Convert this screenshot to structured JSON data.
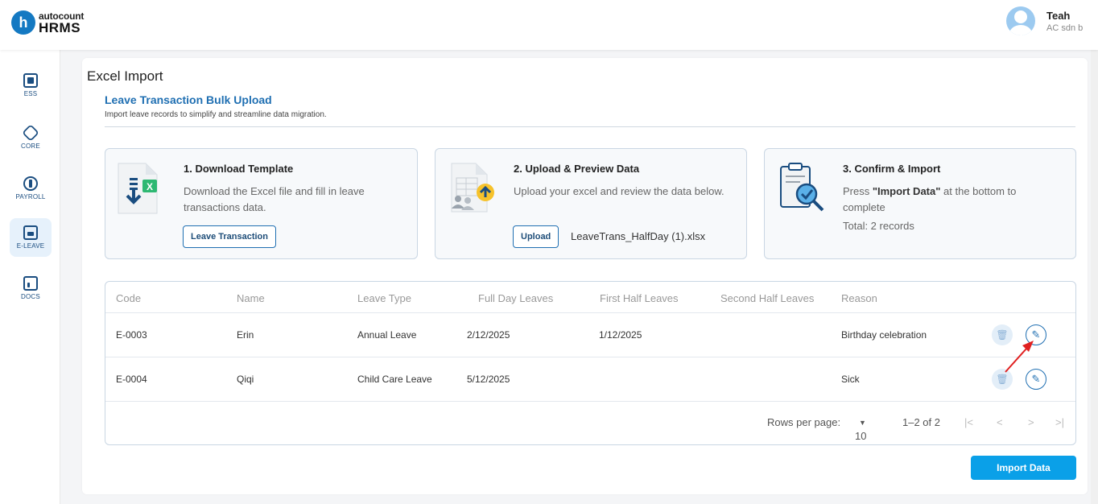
{
  "app": {
    "logo_letter": "h",
    "logo_line1": "autocount",
    "logo_line2": "HRMS"
  },
  "user": {
    "name": "Teah",
    "company": "AC sdn b"
  },
  "sidebar": {
    "items": [
      {
        "label": "ESS",
        "icon": "id-badge-icon"
      },
      {
        "label": "CORE",
        "icon": "cube-icon"
      },
      {
        "label": "PAYROLL",
        "icon": "dollar-coin-icon"
      },
      {
        "label": "E-LEAVE",
        "icon": "calendar-icon"
      },
      {
        "label": "DOCS",
        "icon": "document-chart-icon"
      }
    ]
  },
  "page": {
    "title": "Excel Import",
    "section_title": "Leave Transaction Bulk Upload",
    "section_subtitle": "Import leave records to simplify and streamline data migration."
  },
  "steps": {
    "download": {
      "title": "1. Download Template",
      "description": "Download the Excel file and fill in leave transactions data.",
      "button": "Leave Transaction"
    },
    "upload": {
      "title": "2. Upload & Preview Data",
      "description": "Upload your excel and review the data below.",
      "button": "Upload",
      "file_name": "LeaveTrans_HalfDay (1).xlsx"
    },
    "confirm": {
      "title": "3. Confirm & Import",
      "desc_prefix": "Press ",
      "desc_bold": "\"Import Data\"",
      "desc_suffix": " at the bottom to complete",
      "total": "Total: 2 records"
    }
  },
  "table": {
    "columns": [
      "Code",
      "Name",
      "Leave Type",
      "Full Day Leaves",
      "First Half Leaves",
      "Second Half Leaves",
      "Reason"
    ],
    "rows": [
      {
        "code": "E-0003",
        "name": "Erin",
        "leave_type": "Annual Leave",
        "full_day": "2/12/2025",
        "first_half": "1/12/2025",
        "second_half": "",
        "reason": "Birthday celebration"
      },
      {
        "code": "E-0004",
        "name": "Qiqi",
        "leave_type": "Child Care Leave",
        "full_day": "5/12/2025",
        "first_half": "",
        "second_half": "",
        "reason": "Sick"
      }
    ],
    "pagination": {
      "rows_per_page_label": "Rows per page:",
      "rows_per_page": "10",
      "range": "1–2 of 2"
    }
  },
  "actions": {
    "import_label": "Import Data"
  },
  "colors": {
    "primary": "#1f6fb2",
    "import_button": "#0aa0e8",
    "annotation": "#e02020"
  }
}
